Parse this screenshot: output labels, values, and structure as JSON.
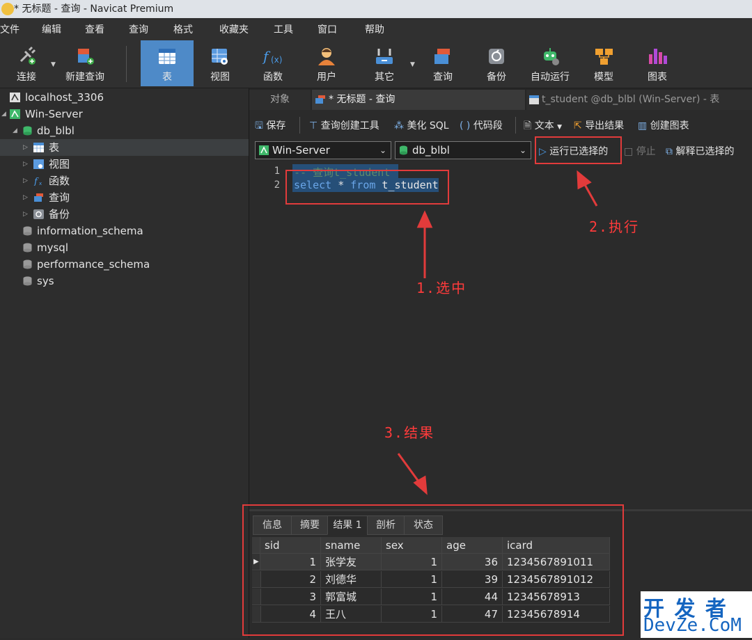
{
  "window": {
    "title": "* 无标题 - 查询 - Navicat Premium"
  },
  "menu": [
    "文件",
    "编辑",
    "查看",
    "查询",
    "格式",
    "收藏夹",
    "工具",
    "窗口",
    "帮助"
  ],
  "toolbar": {
    "connect": "连接",
    "new_query": "新建查询",
    "table": "表",
    "view": "视图",
    "function": "函数",
    "user": "用户",
    "other": "其它",
    "query": "查询",
    "backup": "备份",
    "autorun": "自动运行",
    "model": "模型",
    "chart": "图表"
  },
  "sidebar": {
    "items": [
      {
        "label": "localhost_3306"
      },
      {
        "label": "Win-Server"
      },
      {
        "label": "db_blbl"
      },
      {
        "label": "表"
      },
      {
        "label": "视图"
      },
      {
        "label": "函数"
      },
      {
        "label": "查询"
      },
      {
        "label": "备份"
      },
      {
        "label": "information_schema"
      },
      {
        "label": "mysql"
      },
      {
        "label": "performance_schema"
      },
      {
        "label": "sys"
      }
    ]
  },
  "tabs": {
    "objects": "对象",
    "query": "* 无标题 - 查询",
    "table": "t_student @db_blbl (Win-Server) - 表"
  },
  "query_toolbar": {
    "save": "保存",
    "builder": "查询创建工具",
    "beautify": "美化 SQL",
    "snippet": "代码段",
    "text": "文本",
    "export": "导出结果",
    "create_chart": "创建图表"
  },
  "connection": {
    "server": "Win-Server",
    "database": "db_blbl",
    "run_selected": "运行已选择的",
    "stop": "停止",
    "explain": "解释已选择的"
  },
  "editor": {
    "lines": [
      {
        "no": "1",
        "text": "-- 查询t_student"
      },
      {
        "no": "2",
        "kw1": "select",
        "mid": " * ",
        "kw2": "from",
        "rest": " t_student"
      }
    ]
  },
  "result_tabs": [
    "信息",
    "摘要",
    "结果 1",
    "剖析",
    "状态"
  ],
  "grid": {
    "columns": [
      "sid",
      "sname",
      "sex",
      "age",
      "icard"
    ],
    "rows": [
      [
        "1",
        "张学友",
        "1",
        "36",
        "1234567891011"
      ],
      [
        "2",
        "刘德华",
        "1",
        "39",
        "1234567891012"
      ],
      [
        "3",
        "郭富城",
        "1",
        "44",
        "12345678913"
      ],
      [
        "4",
        "王八",
        "1",
        "47",
        "12345678914"
      ]
    ]
  },
  "annotations": {
    "select": "1.选中",
    "execute": "2.执行",
    "result": "3.结果"
  },
  "watermark": {
    "line1": "开 发 者",
    "line2": "DevZe.CoM"
  },
  "colors": {
    "accent": "#4e8ac8",
    "annotation": "#e23b3b",
    "selection": "#264f78"
  }
}
